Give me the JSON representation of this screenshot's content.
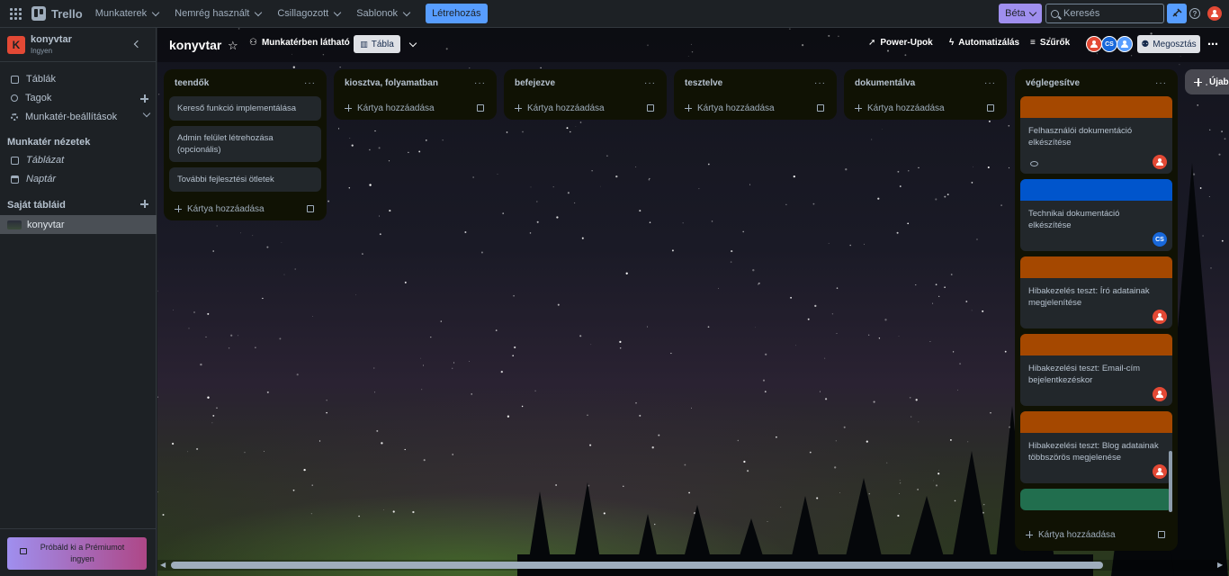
{
  "nav": {
    "logo": "Trello",
    "menus": [
      "Munkaterek",
      "Nemrég használt",
      "Csillagozott",
      "Sablonok"
    ],
    "create": "Létrehozás",
    "beta": "Béta",
    "search_placeholder": "Keresés"
  },
  "sidebar": {
    "workspace_initial": "K",
    "workspace_name": "konyvtar",
    "workspace_plan": "Ingyen",
    "items": [
      {
        "label": "Táblák",
        "icon": "board-icon"
      },
      {
        "label": "Tagok",
        "icon": "members-icon"
      },
      {
        "label": "Munkatér-beállítások",
        "icon": "gear-icon"
      }
    ],
    "views_heading": "Munkatér nézetek",
    "views": [
      {
        "label": "Táblázat",
        "icon": "table-icon"
      },
      {
        "label": "Naptár",
        "icon": "calendar-icon"
      }
    ],
    "boards_heading": "Saját tábláid",
    "boards": [
      "konyvtar"
    ],
    "premium": "Próbáld ki a Prémiumot ingyen"
  },
  "board": {
    "title": "konyvtar",
    "visibility": "Munkatérben látható",
    "view_tab": "Tábla",
    "power_ups": "Power-Upok",
    "automation": "Automatizálás",
    "filters": "Szűrők",
    "share": "Megosztás",
    "member_cs": "CS",
    "add_list": "Újabb",
    "add_card": "Kártya hozzáadása",
    "lists": [
      {
        "title": "teendők",
        "cards": [
          "Kereső funkció implementálása",
          "Admin felület létrehozása (opcionális)",
          "További fejlesztési ötletek"
        ]
      },
      {
        "title": "kiosztva, folyamatban",
        "cards": []
      },
      {
        "title": "befejezve",
        "cards": []
      },
      {
        "title": "tesztelve",
        "cards": []
      },
      {
        "title": "dokumentálva",
        "cards": []
      },
      {
        "title": "véglegesítve",
        "cards": [
          {
            "text": "Felhasználói dokumentáció elkészítése",
            "cover": "#a54800",
            "member": "red",
            "watch": true
          },
          {
            "text": "Technikai dokumentáció elkészítése",
            "cover": "#0055cc",
            "member": "CS"
          },
          {
            "text": "Hibakezelés teszt: Író adatainak megjelenítése",
            "cover": "#a54800",
            "member": "red"
          },
          {
            "text": "Hibakezelési teszt: Email-cím bejelentkezéskor",
            "cover": "#a54800",
            "member": "red"
          },
          {
            "text": "Hibakezelési teszt: Blog adatainak többszörös megjelenése",
            "cover": "#a54800",
            "member": "red"
          },
          {
            "text": "",
            "cover": "#216e4e"
          }
        ]
      }
    ]
  },
  "colors": {
    "accent": "#579dff",
    "beta": "#9f8fef",
    "workspace": "#e34935",
    "list_bg": "#101204",
    "card_bg": "#22272b"
  }
}
